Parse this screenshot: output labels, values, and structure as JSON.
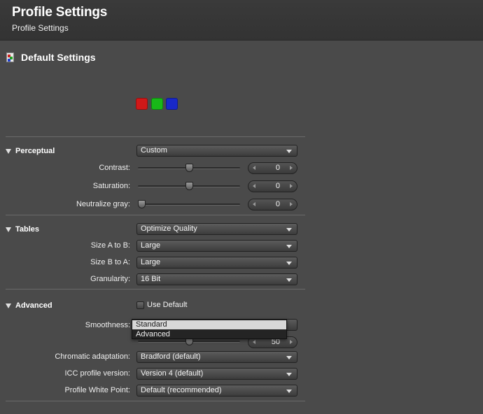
{
  "header": {
    "title": "Profile Settings",
    "subtitle": "Profile Settings"
  },
  "section": {
    "title": "Default Settings",
    "icon": "profile-document-icon"
  },
  "swatches": {
    "colors": [
      "#d01818",
      "#18b818",
      "#1828c8"
    ]
  },
  "perceptual": {
    "title": "Perceptual",
    "mode": "Custom",
    "contrast": {
      "label": "Contrast:",
      "value": "0",
      "level": 0.5
    },
    "saturation": {
      "label": "Saturation:",
      "value": "0",
      "level": 0.5
    },
    "neutralize": {
      "label": "Neutralize gray:",
      "value": "0",
      "level": 0.0
    }
  },
  "tables": {
    "title": "Tables",
    "mode": "Optimize Quality",
    "size_a_to_b": {
      "label": "Size A to B:",
      "value": "Large"
    },
    "size_b_to_a": {
      "label": "Size B to A:",
      "value": "Large"
    },
    "granularity": {
      "label": "Granularity:",
      "value": "16 Bit"
    }
  },
  "advanced": {
    "title": "Advanced",
    "use_default": "Use Default",
    "smoothness": {
      "label": "Smoothness:",
      "options": [
        "Standard",
        "Advanced"
      ],
      "value": "50",
      "level": 0.5
    },
    "chromatic": {
      "label": "Chromatic adaptation:",
      "value": "Bradford (default)"
    },
    "icc_version": {
      "label": "ICC profile version:",
      "value": "Version 4 (default)"
    },
    "white_point": {
      "label": "Profile White Point:",
      "value": "Default (recommended)"
    }
  }
}
